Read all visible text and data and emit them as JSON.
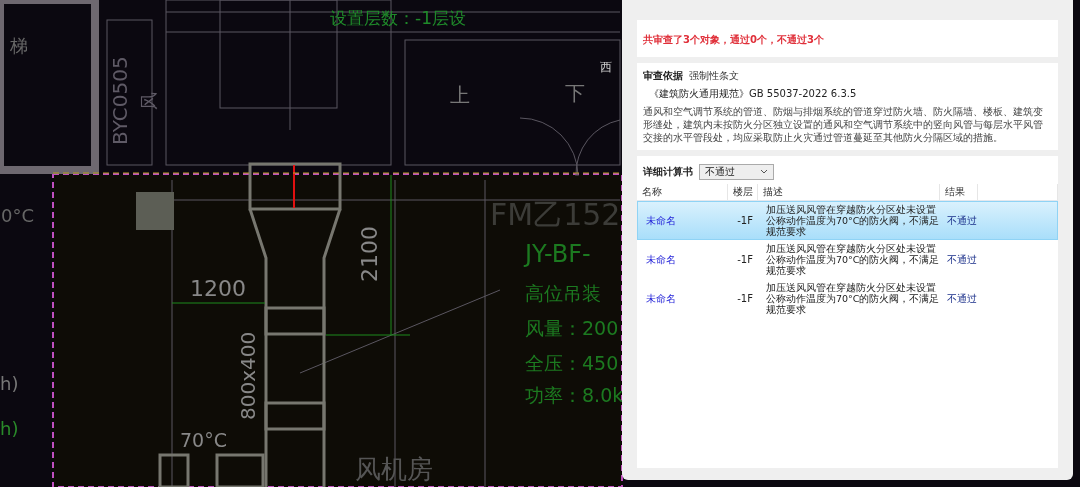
{
  "cad_labels": [
    {
      "text": "设置层数：-1层设"
    },
    {
      "text": "西"
    },
    {
      "text": "BYC0505"
    },
    {
      "text": "风"
    },
    {
      "text": "上"
    },
    {
      "text": "下"
    },
    {
      "text": "梯"
    },
    {
      "text": "FM乙152"
    },
    {
      "text": "JY-BF-"
    },
    {
      "text": "高位吊装"
    },
    {
      "text": "风量：200"
    },
    {
      "text": "全压：450"
    },
    {
      "text": "功率：8.0k"
    },
    {
      "text": "1200"
    },
    {
      "text": "2100"
    },
    {
      "text": "800x400"
    },
    {
      "text": "70°C"
    },
    {
      "text": "风机房"
    },
    {
      "text": "0°C"
    },
    {
      "text": "h)"
    },
    {
      "text": "h)"
    }
  ],
  "summary": "共审查了3个对象，通过0个，不通过3个",
  "basis": {
    "label": "审查依据",
    "tag": "强制性条文",
    "code": "《建筑防火通用规范》GB 55037-2022 6.3.5",
    "text": "通风和空气调节系统的管道、防烟与排烟系统的管道穿过防火墙、防火隔墙、楼板、建筑变形缝处，建筑内未按防火分区独立设置的通风和空气调节系统中的竖向风管与每层水平风管交接的水平管段处，均应采取防止火灾通过管道蔓延至其他防火分隔区域的措施。"
  },
  "details": {
    "label": "详细计算书",
    "filter": "不通过"
  },
  "table": {
    "columns": [
      "名称",
      "楼层",
      "描述",
      "结果"
    ],
    "rows": [
      {
        "name": "未命名",
        "floor": "-1F",
        "description": "加压送风风管在穿越防火分区处未设置公称动作温度为70°C的防火阀，不满足规范要求",
        "result": "不通过",
        "selected": true
      },
      {
        "name": "未命名",
        "floor": "-1F",
        "description": "加压送风风管在穿越防火分区处未设置公称动作温度为70°C的防火阀，不满足规范要求",
        "result": "不通过",
        "selected": false
      },
      {
        "name": "未命名",
        "floor": "-1F",
        "description": "加压送风风管在穿越防火分区处未设置公称动作温度为70°C的防火阀，不满足规范要求",
        "result": "不通过",
        "selected": false
      }
    ]
  }
}
